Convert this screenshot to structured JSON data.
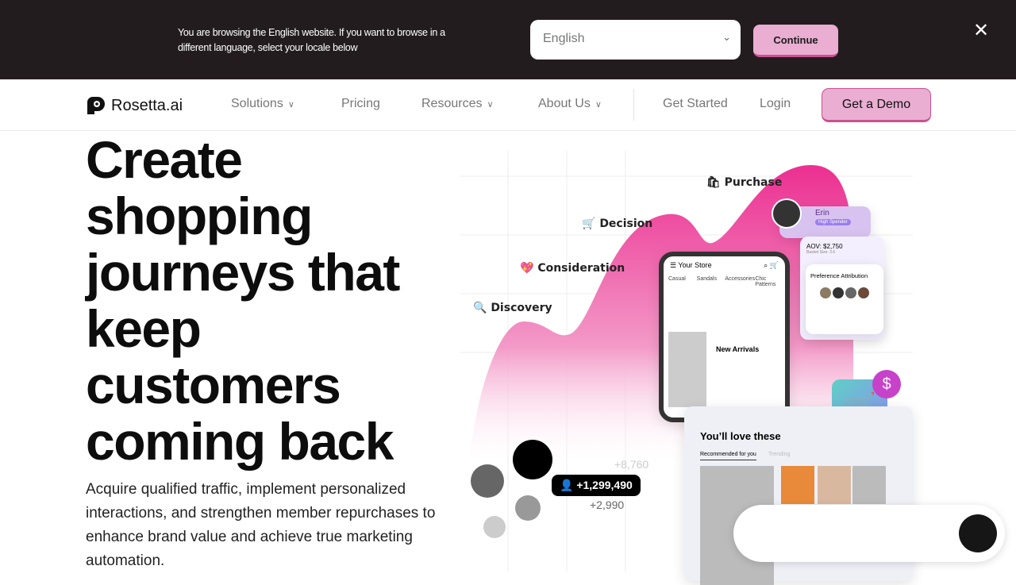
{
  "banner": {
    "message": "You are browsing the English website. If you want to browse in a different language, select your locale below",
    "locale_value": "English",
    "continue_label": "Continue",
    "close_icon": "close-icon"
  },
  "nav": {
    "logo": "Rosetta.ai",
    "items": [
      {
        "label": "Solutions"
      },
      {
        "label": "Pricing"
      },
      {
        "label": "Resources"
      },
      {
        "label": "About Us"
      }
    ],
    "get_started": "Get Started",
    "login": "Login",
    "demo": "Get a Demo"
  },
  "hero": {
    "title": "Create shopping journeys that keep customers coming back",
    "subtitle": "Acquire qualified traffic, implement personalized interactions, and strengthen member repurchases to enhance brand value and achieve true marketing automation."
  },
  "illustration": {
    "stages": [
      "Purchase",
      "Decision",
      "Consideration",
      "Discovery"
    ],
    "profile": {
      "name": "Erin",
      "badge": "High Spender",
      "aov": "AOV: $2,750",
      "basket": "Basket Size: 3.6",
      "pref": "Preference Attribution"
    },
    "store": {
      "title": "Your Store",
      "categories": [
        "Casual",
        "Sandals",
        "Accessories",
        "Chic Patterns"
      ],
      "section": "New Arrivals"
    },
    "reco": {
      "title": "You’ll love these",
      "tab1": "Recommended for you",
      "tab2": "Trending"
    },
    "counts": [
      "+8,760",
      "+1,299,490",
      "+2,990"
    ]
  },
  "colors": {
    "accent": "#eaaed2",
    "banner_bg": "#231c1e",
    "wave": "#ec3f9b"
  }
}
